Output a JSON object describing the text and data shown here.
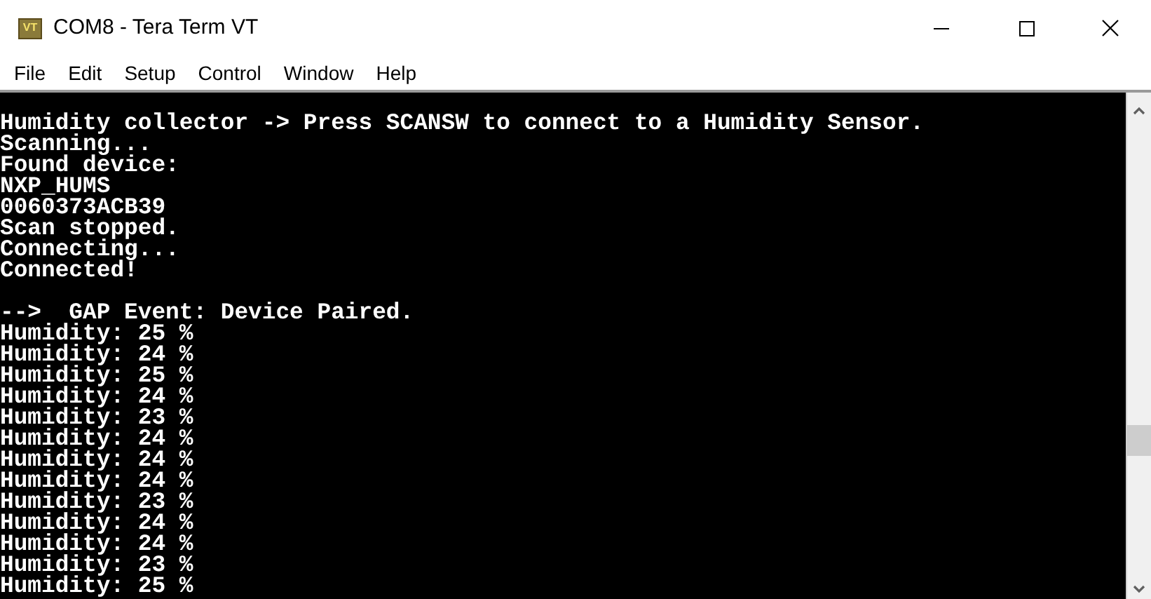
{
  "window": {
    "title": "COM8 - Tera Term VT",
    "app_icon_text": "VT"
  },
  "menu": [
    "File",
    "Edit",
    "Setup",
    "Control",
    "Window",
    "Help"
  ],
  "terminal": {
    "lines": [
      {
        "kind": "text",
        "text": "Humidity collector -> Press SCANSW to connect to a Humidity Sensor."
      },
      {
        "kind": "text",
        "text": "Scanning..."
      },
      {
        "kind": "text",
        "text": "Found device:"
      },
      {
        "kind": "text",
        "text": "NXP_HUMS"
      },
      {
        "kind": "text",
        "text": "0060373ACB39"
      },
      {
        "kind": "text",
        "text": "Scan stopped."
      },
      {
        "kind": "text",
        "text": "Connecting..."
      },
      {
        "kind": "text",
        "text": "Connected!"
      },
      {
        "kind": "blank"
      },
      {
        "kind": "text",
        "text": "-->  GAP Event: Device Paired."
      },
      {
        "kind": "text",
        "text": "Humidity: 25 %"
      },
      {
        "kind": "text",
        "text": "Humidity: 24 %"
      },
      {
        "kind": "text",
        "text": "Humidity: 25 %"
      },
      {
        "kind": "text",
        "text": "Humidity: 24 %"
      },
      {
        "kind": "text",
        "text": "Humidity: 23 %"
      },
      {
        "kind": "text",
        "text": "Humidity: 24 %"
      },
      {
        "kind": "text",
        "text": "Humidity: 24 %"
      },
      {
        "kind": "text",
        "text": "Humidity: 24 %"
      },
      {
        "kind": "text",
        "text": "Humidity: 23 %"
      },
      {
        "kind": "text",
        "text": "Humidity: 24 %"
      },
      {
        "kind": "text",
        "text": "Humidity: 24 %"
      },
      {
        "kind": "text",
        "text": "Humidity: 23 %"
      },
      {
        "kind": "text",
        "text": "Humidity: 25 %"
      }
    ]
  }
}
